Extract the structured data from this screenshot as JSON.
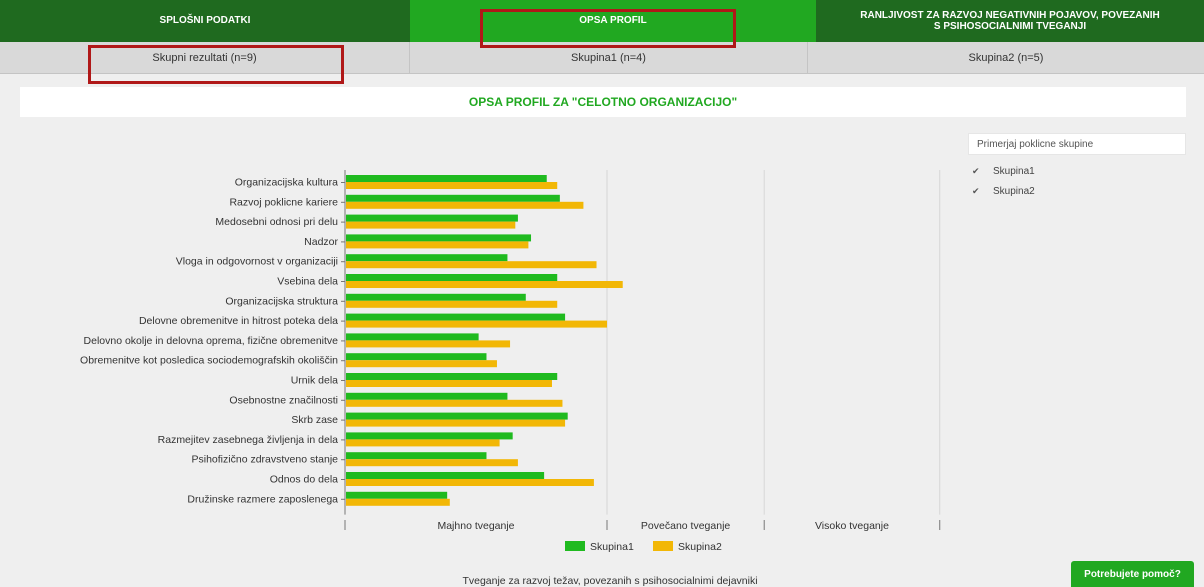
{
  "top_tabs": [
    {
      "label": "SPLOŠNI PODATKI"
    },
    {
      "label": "OPSA PROFIL"
    },
    {
      "label": "RANLJIVOST ZA RAZVOJ NEGATIVNIH POJAVOV, POVEZANIH S PSIHOSOCIALNIMI TVEGANJI"
    }
  ],
  "sub_tabs": [
    {
      "label": "Skupni rezultati (n=9)"
    },
    {
      "label": "Skupina1 (n=4)"
    },
    {
      "label": "Skupina2 (n=5)"
    }
  ],
  "page_title": "OPSA PROFIL ZA \"CELOTNO ORGANIZACIJO\"",
  "filter": {
    "placeholder": "Primerjaj poklicne skupine",
    "options": [
      {
        "label": "Skupina1",
        "checked": true
      },
      {
        "label": "Skupina2",
        "checked": true
      }
    ]
  },
  "help_button": "Potrebujete pomoč?",
  "colors": {
    "primary": "#21a821",
    "dark": "#1f6a1f",
    "series1": "#1fba1f",
    "series2": "#f2b706",
    "highlight": "#b01818"
  },
  "chart_data": {
    "type": "bar",
    "orientation": "horizontal",
    "categories": [
      "Organizacijska kultura",
      "Razvoj poklicne kariere",
      "Medosebni odnosi pri delu",
      "Nadzor",
      "Vloga in odgovornost v organizaciji",
      "Vsebina dela",
      "Organizacijska struktura",
      "Delovne obremenitve in hitrost poteka dela",
      "Delovno okolje in delovna oprema, fizične obremenitve",
      "Obremenitve kot posledica sociodemografskih okoliščin",
      "Urnik dela",
      "Osebnostne značilnosti",
      "Skrb zase",
      "Razmejitev zasebnega življenja in dela",
      "Psihofizično zdravstveno stanje",
      "Odnos do dela",
      "Družinske razmere zaposlenega"
    ],
    "series": [
      {
        "name": "Skupina1",
        "values": [
          0.77,
          0.82,
          0.66,
          0.71,
          0.62,
          0.81,
          0.69,
          0.84,
          0.51,
          0.54,
          0.81,
          0.62,
          0.85,
          0.64,
          0.54,
          0.76,
          0.39
        ]
      },
      {
        "name": "Skupina2",
        "values": [
          0.81,
          0.91,
          0.65,
          0.7,
          0.96,
          1.06,
          0.81,
          1.0,
          0.63,
          0.58,
          0.79,
          0.83,
          0.84,
          0.59,
          0.66,
          0.95,
          0.4
        ]
      }
    ],
    "zones": [
      "Majhno tveganje",
      "Povečano tveganje",
      "Visoko tveganje"
    ],
    "zone_boundaries": [
      0,
      1,
      1.6,
      2.27
    ],
    "xlim": [
      0,
      2.27
    ],
    "xlabel": "Tveganje za razvoj težav, povezanih s psihosocialnimi dejavniki",
    "legend": "bottom"
  }
}
